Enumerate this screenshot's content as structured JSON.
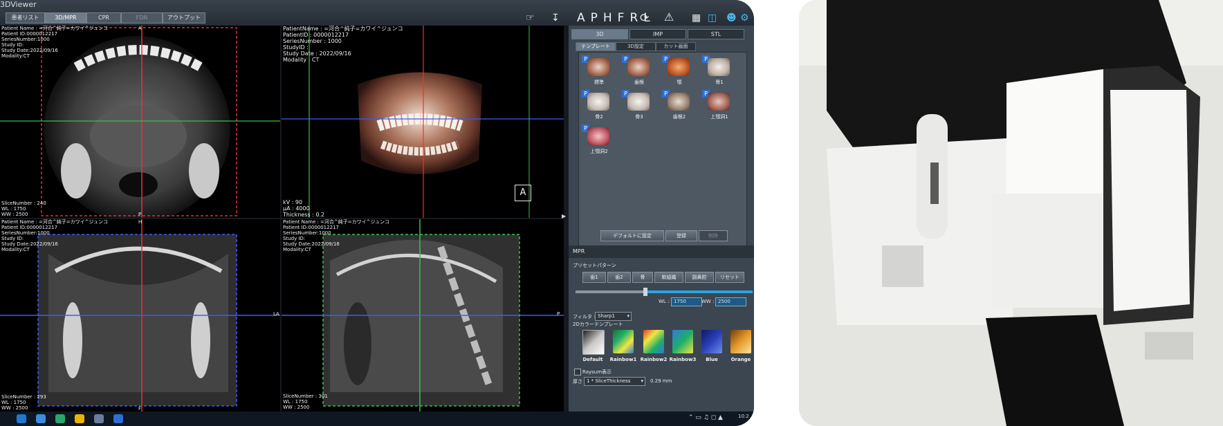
{
  "app": {
    "title": "3DViewer",
    "tabs": [
      "患者リスト",
      "3D/MPR",
      "CPR",
      "FDN",
      "アウトプット"
    ],
    "toolbar_letters": "APHFRL",
    "tool_icons": [
      "pan-icon",
      "download-icon",
      "rotate-icon",
      "warning-icon",
      "grid-icon",
      "layout-icon",
      "user-icon",
      "settings-icon"
    ]
  },
  "viewports": {
    "axial": {
      "info_lines": [
        "Patient Name : =河合^純子=カワイ^ジュンコ",
        "Patient ID:0000012217",
        "SeriesNumber:1000",
        "Study ID:",
        "Study Date:2022/09/16",
        "Modality:CT"
      ],
      "footer_lines": [
        "SliceNumber : 240",
        "WL : 1750",
        "WW : 2500"
      ],
      "marker_a": "A",
      "marker_p": "P"
    },
    "volume": {
      "info_lines": [
        "PatientName : =河合^純子=カワイ^ジュンコ",
        "PatientID : 0000012217",
        "SeriesNumber : 1000",
        "StudyID :",
        "Study Date : 2022/09/16",
        "Modality : CT"
      ],
      "footer_lines": [
        "kV : 90",
        "μA : 4000",
        "Thickness : 0.2"
      ],
      "orientation_box": "A"
    },
    "coronal": {
      "info_lines": [
        "Patient Name : =河合^純子=カワイ^ジュンコ",
        "Patient ID:0000012217",
        "SeriesNumber:1000",
        "Study ID:",
        "Study Date:2022/09/16",
        "Modality:CT"
      ],
      "footer_lines": [
        "SliceNumber : 293",
        "WL : 1750",
        "WW : 2500"
      ],
      "marker_h": "H",
      "marker_f": "F",
      "marker_la": "LA"
    },
    "sagittal": {
      "info_lines": [
        "Patient Name : =河合^純子=カワイ^ジュンコ",
        "Patient ID:0000012217",
        "SeriesNumber:1000",
        "Study ID:",
        "Study Date:2022/09/16",
        "Modality:CT"
      ],
      "footer_lines": [
        "SliceNumber : 301",
        "WL : 1750",
        "WW : 2500"
      ],
      "marker_p": "P"
    }
  },
  "panel": {
    "main_tabs": [
      "3D",
      "IMP",
      "STL"
    ],
    "sub_tabs": [
      "テンプレート",
      "3D設定",
      "カット画面"
    ],
    "templates": [
      "標準",
      "歯根",
      "顎",
      "骨1",
      "骨2",
      "骨3",
      "歯根2",
      "上顎洞1",
      "上顎洞2"
    ],
    "template_buttons": [
      "デフォルトに設定",
      "登録",
      "削除"
    ],
    "mpr_title": "MPR",
    "preset_label": "プリセットパターン",
    "presets": [
      "歯1",
      "歯2",
      "骨",
      "軟組織",
      "副鼻腔",
      "リセット"
    ],
    "wl_label": "WL :",
    "wl_value": "1750",
    "ww_label": "WW :",
    "ww_value": "2500",
    "filter_label": "フィルタ :",
    "filter_value": "Sharp1",
    "colormap_label": "2Dカラーテンプレート",
    "colormaps": [
      {
        "name": "Default",
        "color": "#9aa6ad"
      },
      {
        "name": "Rainbow1",
        "color": "#1fae6a"
      },
      {
        "name": "Rainbow2",
        "color": "#e03a2a"
      },
      {
        "name": "Rainbow3",
        "color": "#2e7ad6"
      },
      {
        "name": "Blue",
        "color": "#2b3fb8"
      },
      {
        "name": "Orange",
        "color": "#e49a2a"
      }
    ],
    "raysum_label": "Raysum表示",
    "thickness_label": "厚さ :",
    "thickness_value": "1 * SliceThickness",
    "thickness_mm": "0.29 mm"
  },
  "taskbar": {
    "clock": "10:2"
  }
}
